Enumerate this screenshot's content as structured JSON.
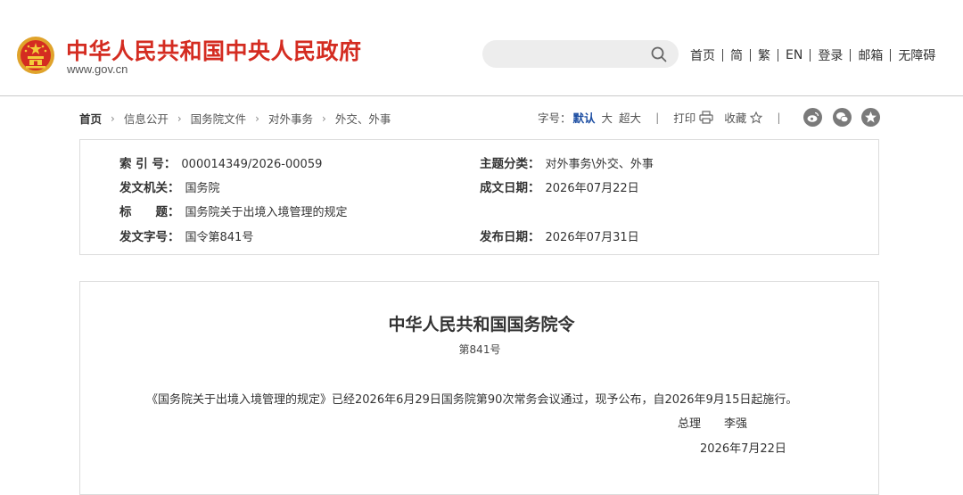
{
  "header": {
    "site_title": "中华人民共和国中央人民政府",
    "site_url": "www.gov.cn",
    "search_placeholder": "",
    "nav": [
      "首页",
      "简",
      "繁",
      "EN",
      "登录",
      "邮箱",
      "无障碍"
    ]
  },
  "breadcrumb": {
    "items": [
      "首页",
      "信息公开",
      "国务院文件",
      "对外事务",
      "外交、外事"
    ]
  },
  "tools": {
    "font_label": "字号：",
    "font_default": "默认",
    "font_large": "大",
    "font_xlarge": "超大",
    "print_label": "打印",
    "favorite_label": "收藏",
    "share_icons": [
      "weibo-icon",
      "wechat-icon",
      "qzone-icon"
    ]
  },
  "info": {
    "index_label": "索 引 号：",
    "index_value": "000014349/2026-00059",
    "topic_label": "主题分类：",
    "topic_value": "对外事务\\外交、外事",
    "issuer_label": "发文机关：",
    "issuer_value": "国务院",
    "written_label": "成文日期：",
    "written_value": "2026年07月22日",
    "title_label": "标　　题：",
    "title_value": "国务院关于出境入境管理的规定",
    "doc_no_label": "发文字号：",
    "doc_no_value": "国令第841号",
    "publish_label": "发布日期：",
    "publish_value": "2026年07月31日"
  },
  "document": {
    "title": "中华人民共和国国务院令",
    "number": "第841号",
    "paragraph": "《国务院关于出境入境管理的规定》已经2026年6月29日国务院第90次常务会议通过，现予公布，自2026年9月15日起施行。",
    "sign_title": "总理",
    "sign_name": "李强",
    "date": "2026年7月22日"
  },
  "colors": {
    "brand_red": "#d42c21",
    "accent_blue": "#1e4fa3",
    "border": "#dcdcdc"
  }
}
